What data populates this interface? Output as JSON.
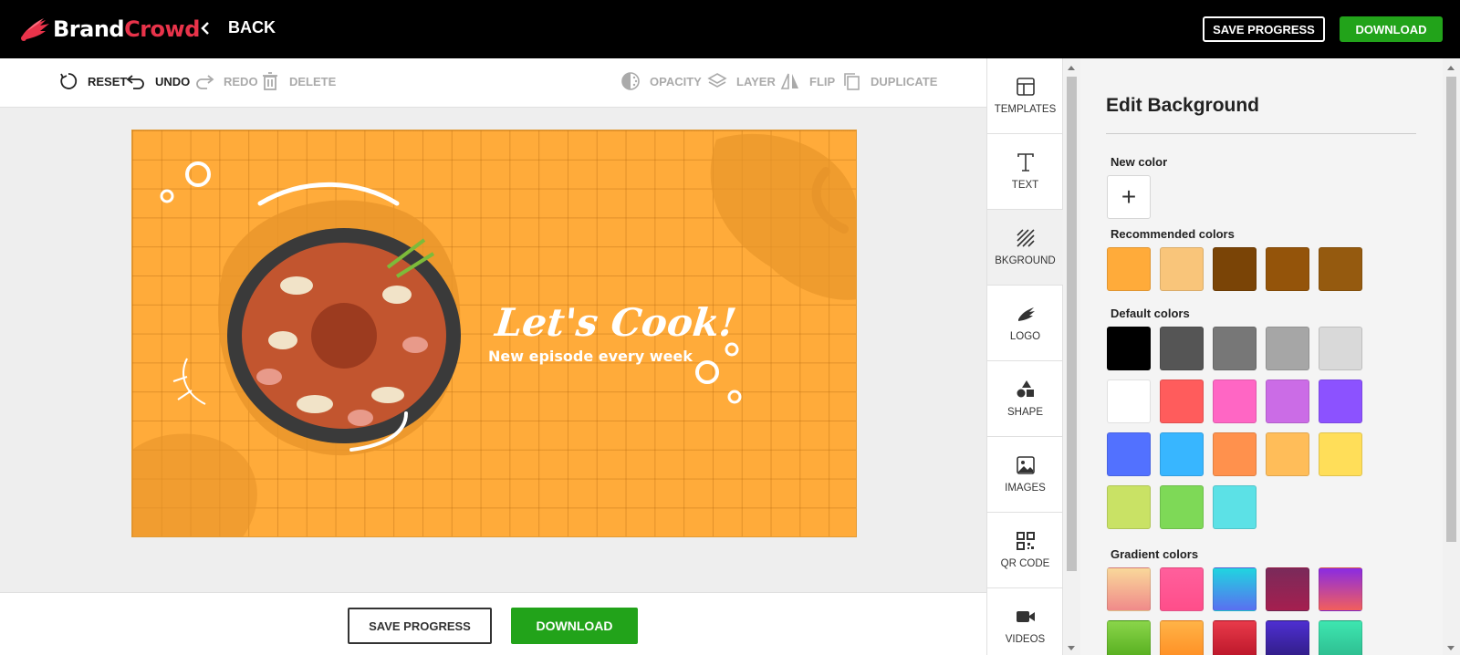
{
  "header": {
    "brand_part1": "Brand",
    "brand_part2": "Crowd",
    "back_label": "BACK",
    "save_label": "SAVE PROGRESS",
    "download_label": "DOWNLOAD"
  },
  "toolbar": {
    "reset": "RESET",
    "undo": "UNDO",
    "redo": "REDO",
    "delete": "DELETE",
    "opacity": "OPACITY",
    "layer": "LAYER",
    "flip": "FLIP",
    "duplicate": "DUPLICATE"
  },
  "design": {
    "headline": "Let's Cook!",
    "subline": "New episode every week",
    "background_color": "#ffab3a"
  },
  "bottom": {
    "save_label": "SAVE PROGRESS",
    "download_label": "DOWNLOAD"
  },
  "sidenav": [
    {
      "label": "TEMPLATES",
      "icon": "templates-icon"
    },
    {
      "label": "TEXT",
      "icon": "text-icon"
    },
    {
      "label": "BKGROUND",
      "icon": "background-icon",
      "active": true
    },
    {
      "label": "LOGO",
      "icon": "logo-icon"
    },
    {
      "label": "SHAPE",
      "icon": "shape-icon"
    },
    {
      "label": "IMAGES",
      "icon": "image-icon"
    },
    {
      "label": "QR CODE",
      "icon": "qr-code-icon"
    },
    {
      "label": "VIDEOS",
      "icon": "video-icon"
    }
  ],
  "panel": {
    "title": "Edit Background",
    "new_color_label": "New color",
    "add_symbol": "+",
    "recommended_label": "Recommended colors",
    "default_label": "Default colors",
    "gradient_label": "Gradient colors",
    "recommended_colors": [
      "#ffab3a",
      "#f9c57a",
      "#7a4406",
      "#94540a",
      "#955a0f"
    ],
    "default_colors": [
      "#000000",
      "#555555",
      "#777777",
      "#a6a6a6",
      "#d9d9d9",
      "#ffffff",
      "#ff5c5c",
      "#ff66c4",
      "#cb6ce6",
      "#8c52ff",
      "#5271ff",
      "#38b6ff",
      "#ff914d",
      "#ffbd59",
      "#ffde59",
      "#c9e265",
      "#7ed957",
      "#5ce1e6"
    ],
    "gradient_colors": [
      [
        "#f9d89a",
        "#f08a8a"
      ],
      [
        "#ff5f9c",
        "#ff4e8a"
      ],
      [
        "#20d5e0",
        "#5a6ff0"
      ],
      [
        "#7a2a5a",
        "#a51f4f"
      ],
      [
        "#8a2be2",
        "#f25f5c"
      ],
      [
        "#8ad54a",
        "#4ea818"
      ],
      [
        "#ffb347",
        "#ff8a1f"
      ],
      [
        "#e83a4a",
        "#b41024"
      ],
      [
        "#4e2fd1",
        "#2c1a7a"
      ],
      [
        "#3ee6b0",
        "#2bb68b"
      ]
    ]
  }
}
